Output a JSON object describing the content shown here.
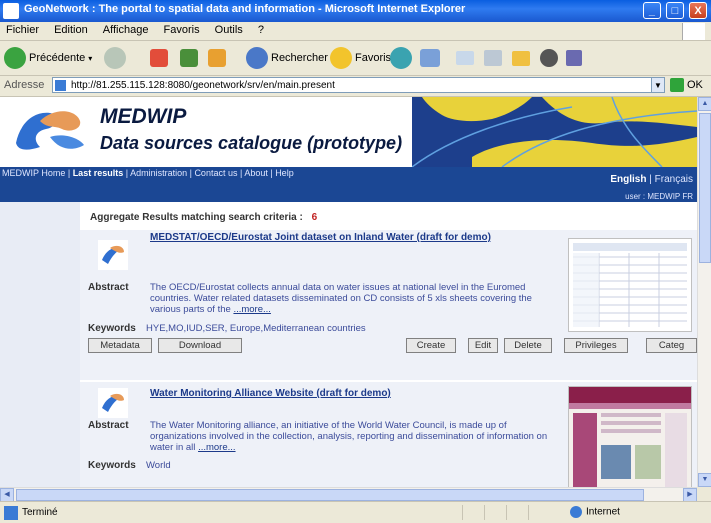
{
  "window": {
    "title": "GeoNetwork : The portal to spatial data and information - Microsoft Internet Explorer",
    "min": "_",
    "max": "□",
    "close": "X"
  },
  "menu": [
    "Fichier",
    "Edition",
    "Affichage",
    "Favoris",
    "Outils",
    "?"
  ],
  "toolbar": {
    "back": "Précédente",
    "search": "Rechercher",
    "favorites": "Favoris"
  },
  "address": {
    "label": "Adresse",
    "url": "http://81.255.115.128:8080/geonetwork/srv/en/main.present",
    "go": "OK"
  },
  "banner": {
    "title": "MEDWIP",
    "subtitle": "Data sources catalogue (prototype)"
  },
  "nav": {
    "home": "MEDWIP Home",
    "last_results": "Last results",
    "administration": "Administration",
    "contact": "Contact us",
    "about": "About",
    "help": "Help",
    "lang_en": "English",
    "lang_fr": "Français",
    "user": "user : MEDWIP FR"
  },
  "results": {
    "summary_label": "Aggregate Results matching search criteria :",
    "count": "6",
    "records": [
      {
        "title": "MEDSTAT/OECD/Eurostat Joint dataset on Inland Water (draft for demo)",
        "abstract_label": "Abstract",
        "abstract": "The OECD/Eurostat collects annual data on water issues at national level in the Euromed countries. Water related datasets disseminated on CD consists of 5 xls sheets covering the various parts of the",
        "more": "...more...",
        "keywords_label": "Keywords",
        "keywords": "HYE,MO,IUD,SER, Europe,Mediterranean countries"
      },
      {
        "title": "Water Monitoring Alliance Website (draft for demo)",
        "abstract_label": "Abstract",
        "abstract": "The Water Monitoring alliance, an initiative of the World Water Council, is made up of organizations involved in the collection, analysis, reporting and dissemination of information on water in all",
        "more": "...more...",
        "keywords_label": "Keywords",
        "keywords": "World"
      }
    ],
    "buttons": {
      "metadata": "Metadata",
      "download": "Download",
      "create": "Create",
      "edit": "Edit",
      "delete": "Delete",
      "privileges": "Privileges",
      "categories": "Categ"
    }
  },
  "status": {
    "text": "Terminé",
    "zone": "Internet"
  },
  "colors": {
    "nav_bg": "#1b4794",
    "title_blue": "#1c3a8a",
    "text_blue": "#3b4b9a"
  }
}
